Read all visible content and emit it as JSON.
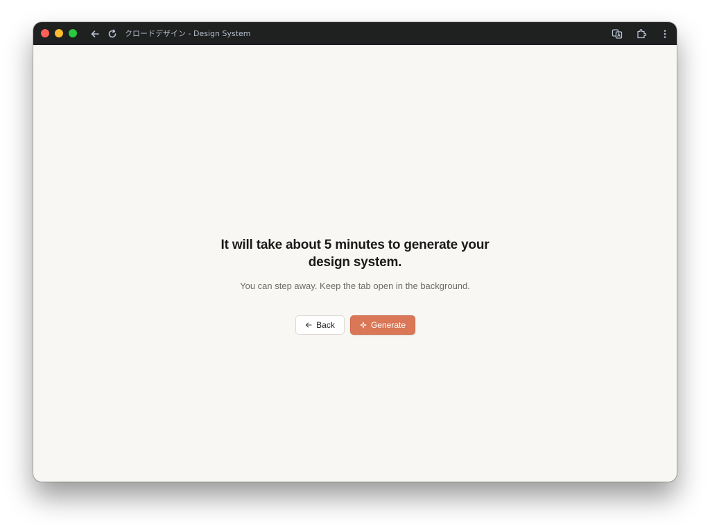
{
  "browser": {
    "tab_title": "クロードデザイン - Design System",
    "icons": {
      "back": "arrow-left-icon",
      "reload": "reload-icon",
      "translate": "translate-icon",
      "extensions": "puzzle-icon",
      "menu": "kebab-menu-icon"
    },
    "traffic_lights": {
      "close": "#fe5f57",
      "minimize": "#febc2e",
      "maximize": "#28c840"
    }
  },
  "main": {
    "heading": "It will take about 5 minutes to generate your design system.",
    "subtext": "You can step away. Keep the tab open in the background.",
    "back_button": {
      "label": "Back",
      "icon": "arrow-left-icon"
    },
    "generate_button": {
      "label": "Generate",
      "icon": "sparkle-icon"
    }
  },
  "colors": {
    "accent": "#d97757",
    "page_background": "#f9f7f3",
    "titlebar": "#1f2020"
  }
}
